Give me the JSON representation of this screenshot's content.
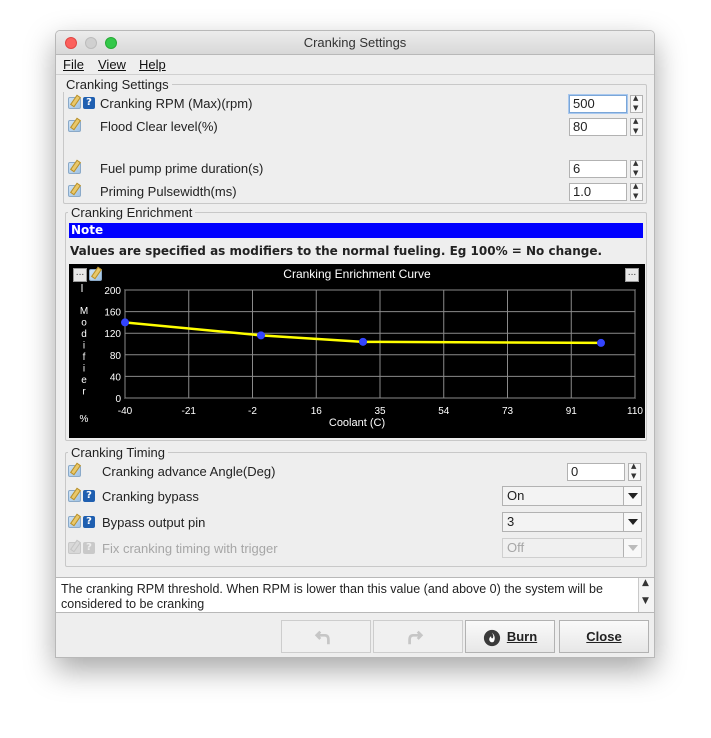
{
  "window": {
    "title": "Cranking Settings"
  },
  "menu": {
    "file": "File",
    "view": "View",
    "help": "Help"
  },
  "cranking_settings": {
    "group_title": "Cranking Settings",
    "rpm": {
      "label": "Cranking RPM (Max)(rpm)",
      "value": "500"
    },
    "flood": {
      "label": "Flood Clear level(%)",
      "value": "80"
    },
    "pump": {
      "label": "Fuel pump prime duration(s)",
      "value": "6"
    },
    "prime": {
      "label": "Priming Pulsewidth(ms)",
      "value": "1.0"
    }
  },
  "enrichment": {
    "group_title": "Cranking Enrichment",
    "note_title": "Note",
    "note_text": "Values are specified as modifiers to the normal fueling. Eg 100% = No change.",
    "chart_button": "..."
  },
  "chart_data": {
    "type": "line",
    "title": "Cranking Enrichment Curve",
    "xlabel": "Coolant (C)",
    "ylabel": "Modifier",
    "ylabel_unit": "%",
    "x_ticks": [
      "-40",
      "-21",
      "-2",
      "16",
      "35",
      "54",
      "73",
      "91",
      "110"
    ],
    "y_ticks": [
      "200",
      "160",
      "120",
      "80",
      "40",
      "0"
    ],
    "xlim": [
      -40,
      110
    ],
    "ylim": [
      0,
      200
    ],
    "grid": true,
    "line_color": "#ffff00",
    "point_color": "#3344ff",
    "series": [
      {
        "x": [
          -40,
          0,
          30,
          100
        ],
        "y": [
          140,
          116,
          104,
          102
        ]
      }
    ]
  },
  "timing": {
    "group_title": "Cranking Timing",
    "advance": {
      "label": "Cranking advance Angle(Deg)",
      "value": "0"
    },
    "bypass": {
      "label": "Cranking bypass",
      "value": "On"
    },
    "pin": {
      "label": "Bypass output pin",
      "value": "3"
    },
    "fix": {
      "label": "Fix cranking timing with trigger",
      "value": "Off"
    }
  },
  "status": {
    "text": "The cranking RPM threshold. When RPM is lower than this value (and above 0) the system will be considered to be cranking"
  },
  "buttons": {
    "undo": "",
    "redo": "",
    "burn": "Burn",
    "close": "Close"
  },
  "colors": {
    "note_bg": "#0000ff",
    "chart_bg": "#000000"
  }
}
